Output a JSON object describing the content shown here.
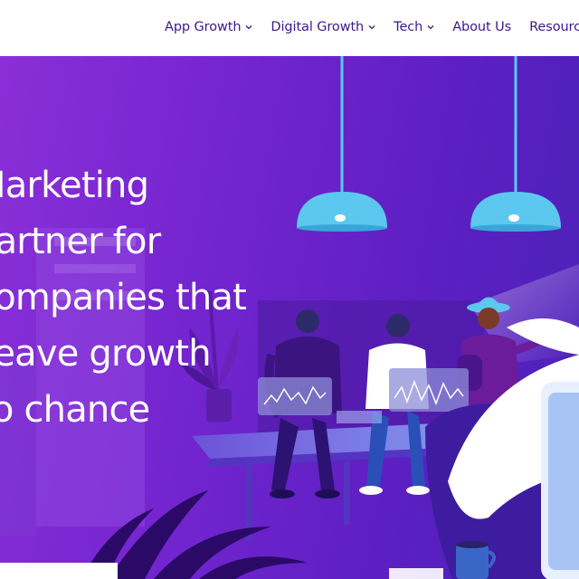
{
  "nav": {
    "items": [
      {
        "label": "App Growth",
        "has_dropdown": true
      },
      {
        "label": "Digital Growth",
        "has_dropdown": true
      },
      {
        "label": "Tech",
        "has_dropdown": true
      },
      {
        "label": "About Us",
        "has_dropdown": false
      },
      {
        "label": "Resources",
        "has_dropdown": true
      }
    ]
  },
  "hero": {
    "headline_lines": [
      "Marketing",
      "partner for",
      "companies that",
      "leave growth",
      "to chance"
    ]
  },
  "colors": {
    "nav_text": "#3a1a8c",
    "hero_bg_start": "#8a2fd8",
    "hero_bg_end": "#4a22b8",
    "lamp": "#5cc8f0"
  }
}
